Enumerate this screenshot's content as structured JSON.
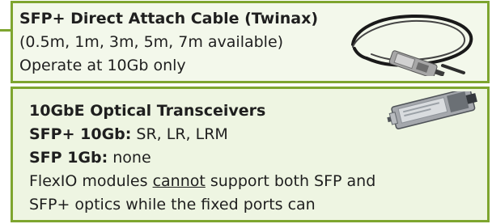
{
  "section_direct_attach": {
    "title": "SFP+ Direct Attach Cable (Twinax)",
    "line_2": "(0.5m, 1m, 3m, 5m, 7m available)",
    "line_3": "Operate at 10Gb only"
  },
  "section_optical": {
    "title": "10GbE Optical Transceivers",
    "sfp_plus_label": "SFP+ 10Gb:",
    "sfp_plus_value": " SR, LR, LRM",
    "sfp_label": "SFP 1Gb:",
    "sfp_value": " none",
    "flexio_line_prefix": "FlexIO modules ",
    "flexio_underlined": "cannot",
    "flexio_line_suffix": " support both SFP and",
    "last_line": "SFP+ optics while the fixed ports can"
  },
  "images": {
    "cable_icon": "sfp-direct-attach-cable-icon",
    "transceiver_icon": "optical-transceiver-icon"
  },
  "colors": {
    "accent_green": "#7ea52f",
    "panel_top_background": "#f3f8eb",
    "panel_bottom_background": "#eef5e2",
    "text": "#1f1f1f"
  }
}
